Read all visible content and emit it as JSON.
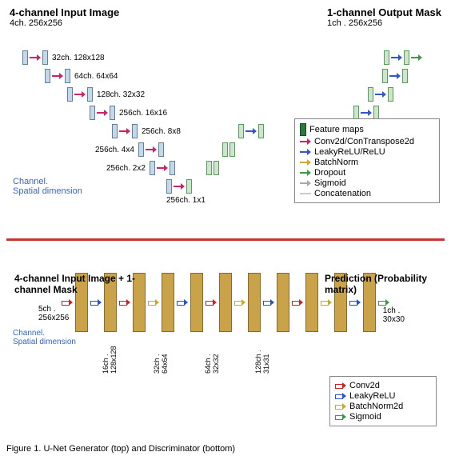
{
  "top": {
    "input_title": "4-channel Input Image",
    "input_dims": "4ch. 256x256",
    "output_title": "1-channel Output Mask",
    "output_dims": "1ch . 256x256",
    "levels": [
      "32ch. 128x128",
      "64ch. 64x64",
      "128ch. 32x32",
      "256ch. 16x16",
      "256ch. 8x8",
      "256ch. 4x4",
      "256ch. 2x2",
      "256ch. 1x1"
    ],
    "axis_label_channel": "Channel.",
    "axis_label_spatial": "Spatial dimension",
    "legend": {
      "feature_maps": "Feature maps",
      "conv": "Conv2d/ConTranspose2d",
      "leaky": "LeakyReLU/ReLU",
      "batchnorm": "BatchNorm",
      "dropout": "Dropout",
      "sigmoid": "Sigmoid",
      "concat": "Concatenation"
    }
  },
  "bottom": {
    "input_title": "4-channel Input Image + 1-channel Mask",
    "input_dims_ch": "5ch .",
    "input_dims_sp": "256x256",
    "output_title": "Prediction (Probability matrix)",
    "output_dims_ch": "1ch .",
    "output_dims_sp": "30x30",
    "axis_label_channel": "Channel.",
    "axis_label_spatial": "Spatial dimension",
    "layers": [
      "16ch . 128x128",
      "32ch . 64x64",
      "64ch . 32x32",
      "128ch . 31x31"
    ],
    "legend": {
      "conv": "Conv2d",
      "leaky": "LeakyReLU",
      "batchnorm": "BatchNorm2d",
      "sigmoid": "Sigmoid"
    }
  },
  "caption": "Figure 1. U-Net Generator (top) and Discriminator (bottom)"
}
